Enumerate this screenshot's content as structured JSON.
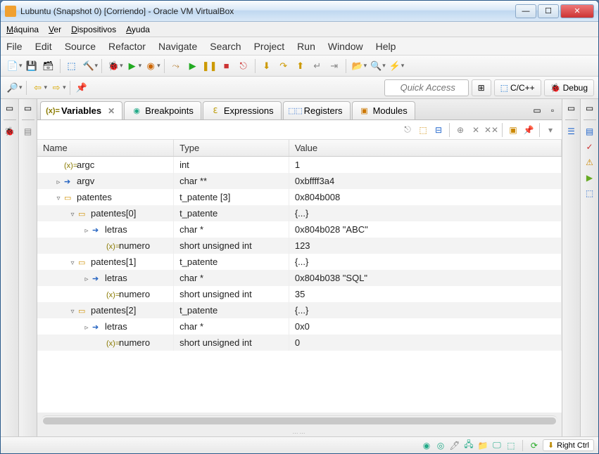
{
  "window": {
    "title": "Lubuntu (Snapshot 0) [Corriendo] - Oracle VM VirtualBox"
  },
  "vm_menu": {
    "machine": "Máquina",
    "view": "Ver",
    "devices": "Dispositivos",
    "help": "Ayuda"
  },
  "ide_menu": {
    "file": "File",
    "edit": "Edit",
    "source": "Source",
    "refactor": "Refactor",
    "navigate": "Navigate",
    "search": "Search",
    "project": "Project",
    "run": "Run",
    "window": "Window",
    "help": "Help"
  },
  "quick_access": {
    "placeholder": "Quick Access"
  },
  "perspectives": {
    "ccpp": "C/C++",
    "debug": "Debug"
  },
  "tabs": {
    "variables": "Variables",
    "breakpoints": "Breakpoints",
    "expressions": "Expressions",
    "registers": "Registers",
    "modules": "Modules"
  },
  "table": {
    "headers": {
      "name": "Name",
      "type": "Type",
      "value": "Value"
    },
    "rows": [
      {
        "name": "argc",
        "type": "int",
        "value": "1",
        "indent": 1,
        "icon": "xeq",
        "expander": ""
      },
      {
        "name": "argv",
        "type": "char **",
        "value": "0xbffff3a4",
        "indent": 1,
        "icon": "arrow",
        "expander": "▹"
      },
      {
        "name": "patentes",
        "type": "t_patente [3]",
        "value": "0x804b008",
        "indent": 1,
        "icon": "box",
        "expander": "▿"
      },
      {
        "name": "patentes[0]",
        "type": "t_patente",
        "value": "{...}",
        "indent": 2,
        "icon": "box",
        "expander": "▿"
      },
      {
        "name": "letras",
        "type": "char *",
        "value": "0x804b028 \"ABC\"",
        "indent": 3,
        "icon": "arrow",
        "expander": "▹"
      },
      {
        "name": "numero",
        "type": "short unsigned int",
        "value": "123",
        "indent": 4,
        "icon": "xeq",
        "expander": ""
      },
      {
        "name": "patentes[1]",
        "type": "t_patente",
        "value": "{...}",
        "indent": 2,
        "icon": "box",
        "expander": "▿"
      },
      {
        "name": "letras",
        "type": "char *",
        "value": "0x804b038 \"SQL\"",
        "indent": 3,
        "icon": "arrow",
        "expander": "▹"
      },
      {
        "name": "numero",
        "type": "short unsigned int",
        "value": "35",
        "indent": 4,
        "icon": "xeq",
        "expander": ""
      },
      {
        "name": "patentes[2]",
        "type": "t_patente",
        "value": "{...}",
        "indent": 2,
        "icon": "box",
        "expander": "▿"
      },
      {
        "name": "letras",
        "type": "char *",
        "value": "0x0",
        "indent": 3,
        "icon": "arrow",
        "expander": "▹"
      },
      {
        "name": "numero",
        "type": "short unsigned int",
        "value": "0",
        "indent": 4,
        "icon": "xeq",
        "expander": ""
      }
    ]
  },
  "statusbar": {
    "host_key": "Right Ctrl"
  }
}
